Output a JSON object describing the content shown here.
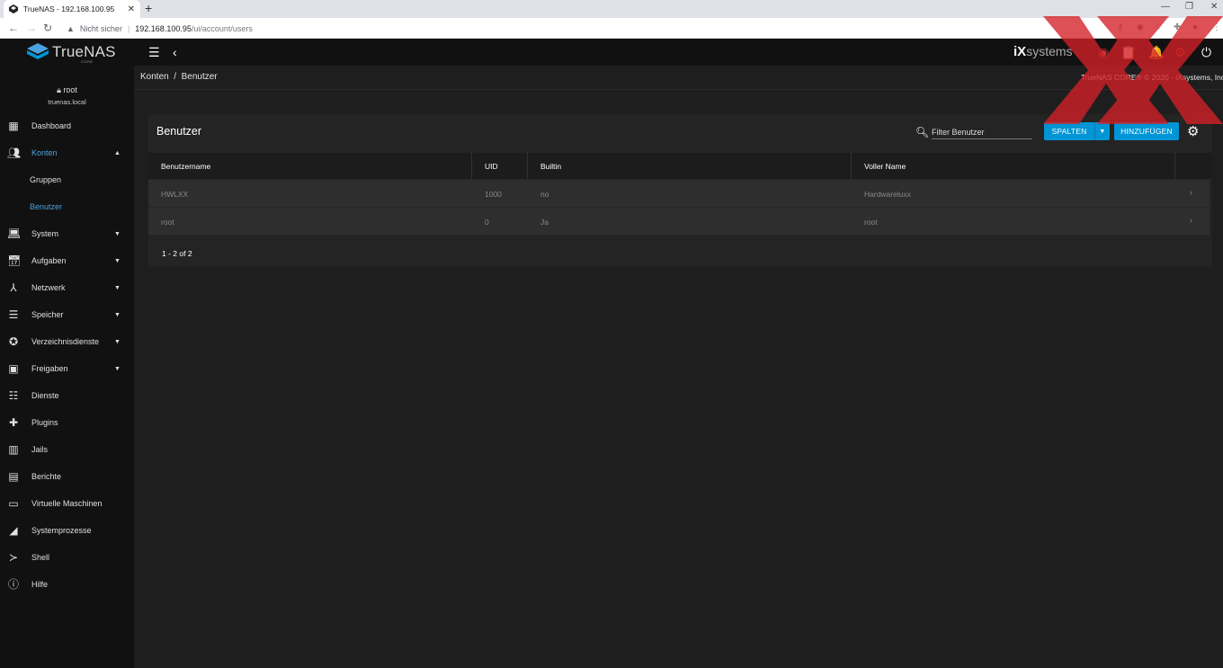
{
  "browser": {
    "tab_title": "TrueNAS - 192.168.100.95",
    "security_label": "Nicht sicher",
    "url_host": "192.168.100.95",
    "url_path": "/ui/account/users"
  },
  "topbar": {
    "brand": "TrueNAS",
    "brand_sub": "CORE",
    "vendor_prefix": "iX",
    "vendor_suffix": "systems"
  },
  "user": {
    "name": "root",
    "host": "truenas.local"
  },
  "sidebar": {
    "items": [
      {
        "label": "Dashboard",
        "icon": "dashboard-icon"
      },
      {
        "label": "Konten",
        "icon": "people-icon"
      },
      {
        "label": "Gruppen"
      },
      {
        "label": "Benutzer"
      },
      {
        "label": "System",
        "icon": "laptop-icon"
      },
      {
        "label": "Aufgaben",
        "icon": "calendar-icon"
      },
      {
        "label": "Netzwerk",
        "icon": "network-icon"
      },
      {
        "label": "Speicher",
        "icon": "storage-icon"
      },
      {
        "label": "Verzeichnisdienste",
        "icon": "directory-icon"
      },
      {
        "label": "Freigaben",
        "icon": "share-icon"
      },
      {
        "label": "Dienste",
        "icon": "sliders-icon"
      },
      {
        "label": "Plugins",
        "icon": "puzzle-icon"
      },
      {
        "label": "Jails",
        "icon": "jail-icon"
      },
      {
        "label": "Berichte",
        "icon": "chart-icon"
      },
      {
        "label": "Virtuelle Maschinen",
        "icon": "monitor-icon"
      },
      {
        "label": "Systemprozesse",
        "icon": "process-icon"
      },
      {
        "label": "Shell",
        "icon": "terminal-icon"
      },
      {
        "label": "Hilfe",
        "icon": "info-icon"
      }
    ]
  },
  "breadcrumb": {
    "parent": "Konten",
    "separator": "/",
    "current": "Benutzer"
  },
  "copyright": "TrueNAS CORE® © 2020 - iXsystems, Inc",
  "card": {
    "title": "Benutzer",
    "filter_placeholder": "Filter Benutzer",
    "columns_button": "SPALTEN",
    "add_button": "HINZUFÜGEN"
  },
  "table": {
    "headers": [
      "Benutzername",
      "UID",
      "Builtin",
      "Voller Name"
    ],
    "rows": [
      {
        "username": "HWLXX",
        "uid": "1000",
        "builtin": "no",
        "full_name": "Hardwareluxx"
      },
      {
        "username": "root",
        "uid": "0",
        "builtin": "Ja",
        "full_name": "root"
      }
    ],
    "pager": "1 - 2 of 2"
  },
  "colors": {
    "accent": "#0095d5",
    "active_nav": "#4aa3df",
    "watermark": "#d42027"
  }
}
